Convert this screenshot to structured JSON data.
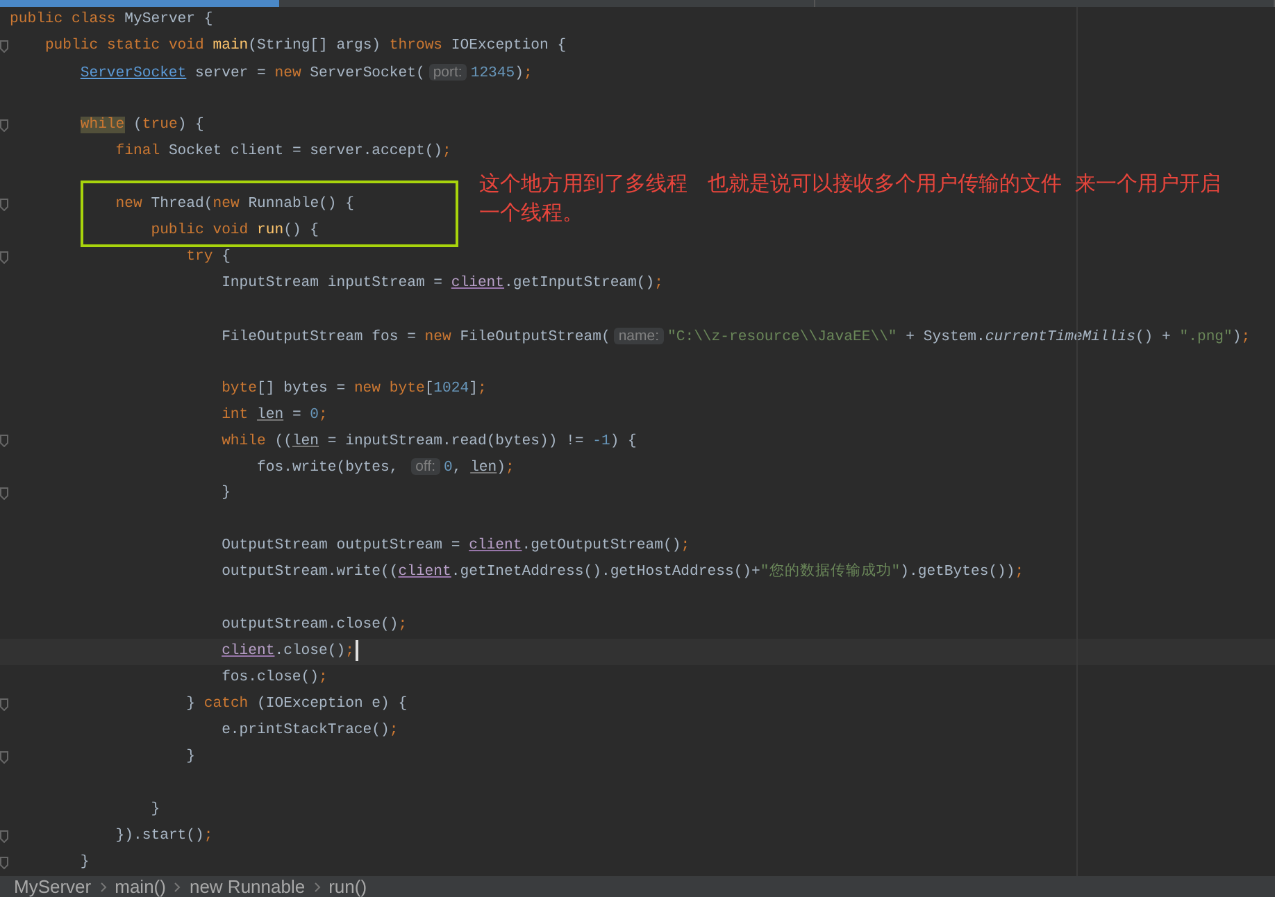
{
  "editor": {
    "lines": [
      {
        "kind": "code",
        "fold": false,
        "current": false,
        "tokens": [
          {
            "kind": "keyword",
            "text": "public class "
          },
          {
            "kind": "plain",
            "text": "MyServer {"
          }
        ]
      },
      {
        "kind": "code",
        "fold": true,
        "current": false,
        "tokens": [
          {
            "kind": "keyword",
            "text": "    public static void "
          },
          {
            "kind": "method",
            "text": "main"
          },
          {
            "kind": "plain",
            "text": "(String[] args) "
          },
          {
            "kind": "keyword",
            "text": "throws "
          },
          {
            "kind": "plain",
            "text": "IOException {"
          }
        ]
      },
      {
        "kind": "code",
        "fold": false,
        "current": false,
        "tokens": [
          {
            "kind": "class-link",
            "text": "        ServerSocket"
          },
          {
            "kind": "plain",
            "text": " server = "
          },
          {
            "kind": "keyword",
            "text": "new "
          },
          {
            "kind": "plain",
            "text": "ServerSocket("
          },
          {
            "kind": "hint",
            "text": "port:"
          },
          {
            "kind": "number",
            "text": "12345"
          },
          {
            "kind": "plain",
            "text": ")"
          },
          {
            "kind": "keyword",
            "text": ";"
          }
        ]
      },
      {
        "kind": "blank"
      },
      {
        "kind": "code",
        "fold": true,
        "current": false,
        "tokens": [
          {
            "kind": "keyword-marked",
            "text": "        while"
          },
          {
            "kind": "plain",
            "text": " ("
          },
          {
            "kind": "keyword",
            "text": "true"
          },
          {
            "kind": "plain",
            "text": ") {"
          }
        ]
      },
      {
        "kind": "code",
        "fold": false,
        "current": false,
        "tokens": [
          {
            "kind": "keyword",
            "text": "            final "
          },
          {
            "kind": "plain",
            "text": "Socket client = server.accept()"
          },
          {
            "kind": "keyword",
            "text": ";"
          }
        ]
      },
      {
        "kind": "blank"
      },
      {
        "kind": "code",
        "fold": true,
        "current": false,
        "tokens": [
          {
            "kind": "keyword",
            "text": "            new "
          },
          {
            "kind": "plain",
            "text": "Thread("
          },
          {
            "kind": "keyword",
            "text": "new "
          },
          {
            "kind": "plain",
            "text": "Runnable() {"
          }
        ]
      },
      {
        "kind": "code",
        "fold": false,
        "current": false,
        "tokens": [
          {
            "kind": "keyword",
            "text": "                public void "
          },
          {
            "kind": "method",
            "text": "run"
          },
          {
            "kind": "plain",
            "text": "() {"
          }
        ]
      },
      {
        "kind": "code",
        "fold": true,
        "current": false,
        "tokens": [
          {
            "kind": "keyword",
            "text": "                    try "
          },
          {
            "kind": "plain",
            "text": "{"
          }
        ]
      },
      {
        "kind": "code",
        "fold": false,
        "current": false,
        "tokens": [
          {
            "kind": "plain",
            "text": "                        InputStream inputStream = "
          },
          {
            "kind": "captured",
            "text": "client"
          },
          {
            "kind": "plain",
            "text": ".getInputStream()"
          },
          {
            "kind": "keyword",
            "text": ";"
          }
        ]
      },
      {
        "kind": "blank"
      },
      {
        "kind": "code",
        "fold": false,
        "current": false,
        "tokens": [
          {
            "kind": "plain",
            "text": "                        FileOutputStream fos = "
          },
          {
            "kind": "keyword",
            "text": "new "
          },
          {
            "kind": "plain",
            "text": "FileOutputStream("
          },
          {
            "kind": "hint",
            "text": "name:"
          },
          {
            "kind": "string",
            "text": "\"C:\\\\z-resource\\\\JavaEE\\\\\""
          },
          {
            "kind": "plain",
            "text": " + System."
          },
          {
            "kind": "italic",
            "text": "currentTimeMillis"
          },
          {
            "kind": "plain",
            "text": "() + "
          },
          {
            "kind": "string",
            "text": "\".png\""
          },
          {
            "kind": "plain",
            "text": ")"
          },
          {
            "kind": "keyword",
            "text": ";"
          }
        ]
      },
      {
        "kind": "blank"
      },
      {
        "kind": "code",
        "fold": false,
        "current": false,
        "tokens": [
          {
            "kind": "keyword",
            "text": "                        byte"
          },
          {
            "kind": "plain",
            "text": "[] bytes = "
          },
          {
            "kind": "keyword",
            "text": "new byte"
          },
          {
            "kind": "plain",
            "text": "["
          },
          {
            "kind": "number",
            "text": "1024"
          },
          {
            "kind": "plain",
            "text": "]"
          },
          {
            "kind": "keyword",
            "text": ";"
          }
        ]
      },
      {
        "kind": "code",
        "fold": false,
        "current": false,
        "tokens": [
          {
            "kind": "keyword",
            "text": "                        int "
          },
          {
            "kind": "var",
            "text": "len"
          },
          {
            "kind": "plain",
            "text": " = "
          },
          {
            "kind": "number",
            "text": "0"
          },
          {
            "kind": "keyword",
            "text": ";"
          }
        ]
      },
      {
        "kind": "code",
        "fold": true,
        "current": false,
        "tokens": [
          {
            "kind": "keyword",
            "text": "                        while "
          },
          {
            "kind": "plain",
            "text": "(("
          },
          {
            "kind": "var",
            "text": "len"
          },
          {
            "kind": "plain",
            "text": " = inputStream.read(bytes)) != "
          },
          {
            "kind": "number",
            "text": "-1"
          },
          {
            "kind": "plain",
            "text": ") {"
          }
        ]
      },
      {
        "kind": "code",
        "fold": false,
        "current": false,
        "tokens": [
          {
            "kind": "plain",
            "text": "                            fos.write(bytes, "
          },
          {
            "kind": "hint",
            "text": "off:"
          },
          {
            "kind": "number",
            "text": "0"
          },
          {
            "kind": "plain",
            "text": ", "
          },
          {
            "kind": "var",
            "text": "len"
          },
          {
            "kind": "plain",
            "text": ")"
          },
          {
            "kind": "keyword",
            "text": ";"
          }
        ]
      },
      {
        "kind": "code",
        "fold": true,
        "current": false,
        "tokens": [
          {
            "kind": "plain",
            "text": "                        }"
          }
        ]
      },
      {
        "kind": "blank"
      },
      {
        "kind": "code",
        "fold": false,
        "current": false,
        "tokens": [
          {
            "kind": "plain",
            "text": "                        OutputStream outputStream = "
          },
          {
            "kind": "captured",
            "text": "client"
          },
          {
            "kind": "plain",
            "text": ".getOutputStream()"
          },
          {
            "kind": "keyword",
            "text": ";"
          }
        ]
      },
      {
        "kind": "code",
        "fold": false,
        "current": false,
        "tokens": [
          {
            "kind": "plain",
            "text": "                        outputStream.write(("
          },
          {
            "kind": "captured",
            "text": "client"
          },
          {
            "kind": "plain",
            "text": ".getInetAddress().getHostAddress()+"
          },
          {
            "kind": "string",
            "text": "\"您的数据传输成功\""
          },
          {
            "kind": "plain",
            "text": ").getBytes())"
          },
          {
            "kind": "keyword",
            "text": ";"
          }
        ]
      },
      {
        "kind": "blank"
      },
      {
        "kind": "code",
        "fold": false,
        "current": false,
        "tokens": [
          {
            "kind": "plain",
            "text": "                        outputStream.close()"
          },
          {
            "kind": "keyword",
            "text": ";"
          }
        ]
      },
      {
        "kind": "code",
        "fold": false,
        "current": true,
        "tokens": [
          {
            "kind": "captured",
            "text": "                        client"
          },
          {
            "kind": "plain",
            "text": ".close()"
          },
          {
            "kind": "keyword",
            "text": ";"
          }
        ]
      },
      {
        "kind": "code",
        "fold": false,
        "current": false,
        "tokens": [
          {
            "kind": "plain",
            "text": "                        fos.close()"
          },
          {
            "kind": "keyword",
            "text": ";"
          }
        ]
      },
      {
        "kind": "code",
        "fold": true,
        "current": false,
        "tokens": [
          {
            "kind": "plain",
            "text": "                    } "
          },
          {
            "kind": "keyword",
            "text": "catch "
          },
          {
            "kind": "plain",
            "text": "(IOException e) {"
          }
        ]
      },
      {
        "kind": "code",
        "fold": false,
        "current": false,
        "tokens": [
          {
            "kind": "plain",
            "text": "                        e.printStackTrace()"
          },
          {
            "kind": "keyword",
            "text": ";"
          }
        ]
      },
      {
        "kind": "code",
        "fold": true,
        "current": false,
        "tokens": [
          {
            "kind": "plain",
            "text": "                    }"
          }
        ]
      },
      {
        "kind": "blank"
      },
      {
        "kind": "code",
        "fold": false,
        "current": false,
        "tokens": [
          {
            "kind": "plain",
            "text": "                }"
          }
        ]
      },
      {
        "kind": "code",
        "fold": true,
        "current": false,
        "tokens": [
          {
            "kind": "plain",
            "text": "            }).start()"
          },
          {
            "kind": "keyword",
            "text": ";"
          }
        ]
      },
      {
        "kind": "code",
        "fold": true,
        "current": false,
        "tokens": [
          {
            "kind": "plain",
            "text": "        }"
          }
        ]
      }
    ]
  },
  "annotation": {
    "text": "这个地方用到了多线程   也就是说可以接收多个用户传输的文件  来一个用户开启一个线程。"
  },
  "breadcrumbs": [
    "MyServer",
    "main()",
    "new Runnable",
    "run()"
  ]
}
